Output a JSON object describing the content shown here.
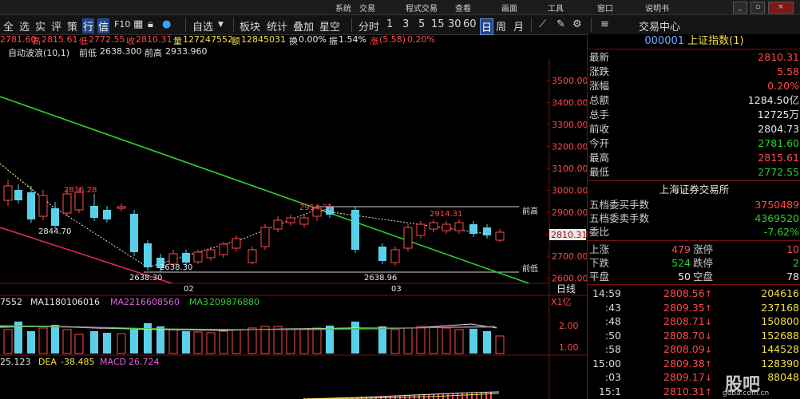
{
  "menu": {
    "items": [
      "系统",
      "交易",
      "程式交易",
      "查看",
      "画面",
      "工具",
      "窗口",
      "说明书"
    ],
    "window_buttons": [
      "_",
      "▫",
      "×"
    ]
  },
  "toolbar": {
    "nav": [
      "全",
      "选",
      "实",
      "评",
      "策"
    ],
    "tabs_a": [
      "行",
      "信"
    ],
    "f10": "F10",
    "self_select": "自选",
    "items": [
      "板块",
      "统计",
      "叠加",
      "星空"
    ],
    "periods": [
      "分时",
      "1",
      "3",
      "5",
      "15",
      "30",
      "60",
      "日",
      "周",
      "月"
    ],
    "trade_center": "交易中心"
  },
  "infobar": {
    "open": "2781.60",
    "high_label": "高",
    "high": "2815.61",
    "low_label": "低",
    "low": "2772.55",
    "close_label": "收",
    "close": "2810.31",
    "vol_label": "量",
    "vol": "127247552",
    "amt_label": "额",
    "amt": "12845031",
    "turnover_label": "换",
    "turnover": "0.00%",
    "amp_label": "振",
    "amp": "1.54%",
    "chg_label": "涨",
    "chg": "(5.58)",
    "chg_pct": "0.20%"
  },
  "zz": {
    "title": "自动波浪(10,1)",
    "prev_low_label": "前低",
    "prev_low": "2638.300",
    "prev_high_label": "前高",
    "prev_high": "2933.960"
  },
  "chart_data": {
    "type": "candlestick",
    "y_ticks": [
      "3500.00",
      "3400.00",
      "3300.00",
      "3200.00",
      "3100.00",
      "3000.00",
      "2900.00",
      "2800.00",
      "2700.00",
      "2600.00"
    ],
    "price_tag": "2810.31",
    "x_labels": [
      "02",
      "03"
    ],
    "annotations": [
      "2816.28",
      "2844.70",
      "2638.30",
      "2638.30",
      "2914.31",
      "2638.96"
    ],
    "ref_labels": [
      "前高",
      "前低"
    ],
    "period_label": "日线",
    "vol_info": {
      "vol": "7552",
      "ma1_label": "MA1",
      "ma1": "180106016",
      "ma2_label": "MA2",
      "ma2": "216608560",
      "ma3_label": "MA3",
      "ma3": "209876880"
    },
    "vol_unit": "X1亿",
    "vol_ticks": [
      "2.00",
      "1.00"
    ],
    "macd_info": {
      "diff": "25.123",
      "dea_label": "DEA",
      "dea": "-38.485",
      "macd_label": "MACD",
      "macd": "26.724"
    }
  },
  "panel": {
    "code": "000001",
    "name": "上证指数(1)",
    "stats": [
      {
        "label": "最新",
        "value": "2810.31",
        "color": "red"
      },
      {
        "label": "涨跌",
        "value": "5.58",
        "color": "red"
      },
      {
        "label": "涨幅",
        "value": "0.20%",
        "color": "red"
      },
      {
        "label": "总额",
        "value": "1284.50亿",
        "color": "white"
      },
      {
        "label": "总手",
        "value": "12725万",
        "color": "white"
      },
      {
        "label": "前收",
        "value": "2804.73",
        "color": "white"
      },
      {
        "label": "今开",
        "value": "2781.60",
        "color": "green"
      },
      {
        "label": "最高",
        "value": "2815.61",
        "color": "red"
      },
      {
        "label": "最低",
        "value": "2772.55",
        "color": "green"
      }
    ],
    "exchange": "上海证券交易所",
    "book": [
      {
        "label": "五档委买手数",
        "value": "3750489",
        "color": "red"
      },
      {
        "label": "五档委卖手数",
        "value": "4369520",
        "color": "green"
      },
      {
        "label": "委比",
        "value": "-7.62%",
        "color": "green"
      }
    ],
    "breadth": [
      {
        "l1": "上涨",
        "v1": "479",
        "l2": "涨停",
        "v2": "10",
        "c": "red"
      },
      {
        "l1": "下跌",
        "v1": "524",
        "l2": "跌停",
        "v2": "2",
        "c": "green"
      },
      {
        "l1": "平盘",
        "v1": "50",
        "l2": "空盘",
        "v2": "78",
        "c": "white"
      }
    ],
    "ticks": [
      {
        "t": "14:59",
        "p": "2808.56",
        "a": "↑",
        "pc": "red",
        "v": "204616"
      },
      {
        "t": ":43",
        "p": "2809.35",
        "a": "↑",
        "pc": "red",
        "v": "237168"
      },
      {
        "t": ":48",
        "p": "2808.71",
        "a": "↓",
        "pc": "red",
        "v": "150800"
      },
      {
        "t": ":50",
        "p": "2808.70",
        "a": "↓",
        "pc": "red",
        "v": "152688"
      },
      {
        "t": ":58",
        "p": "2808.09",
        "a": "↓",
        "pc": "red",
        "v": "144528"
      },
      {
        "t": "15:00",
        "p": "2809.38",
        "a": "↑",
        "pc": "red",
        "v": "128390"
      },
      {
        "t": ":03",
        "p": "2809.17",
        "a": "↓",
        "pc": "red",
        "v": "88048"
      },
      {
        "t": "15:1",
        "p": "2810.31",
        "a": "↑",
        "pc": "red",
        "v": ""
      }
    ]
  },
  "watermark": {
    "main": "股吧",
    "sub": "guba.com.cn"
  }
}
